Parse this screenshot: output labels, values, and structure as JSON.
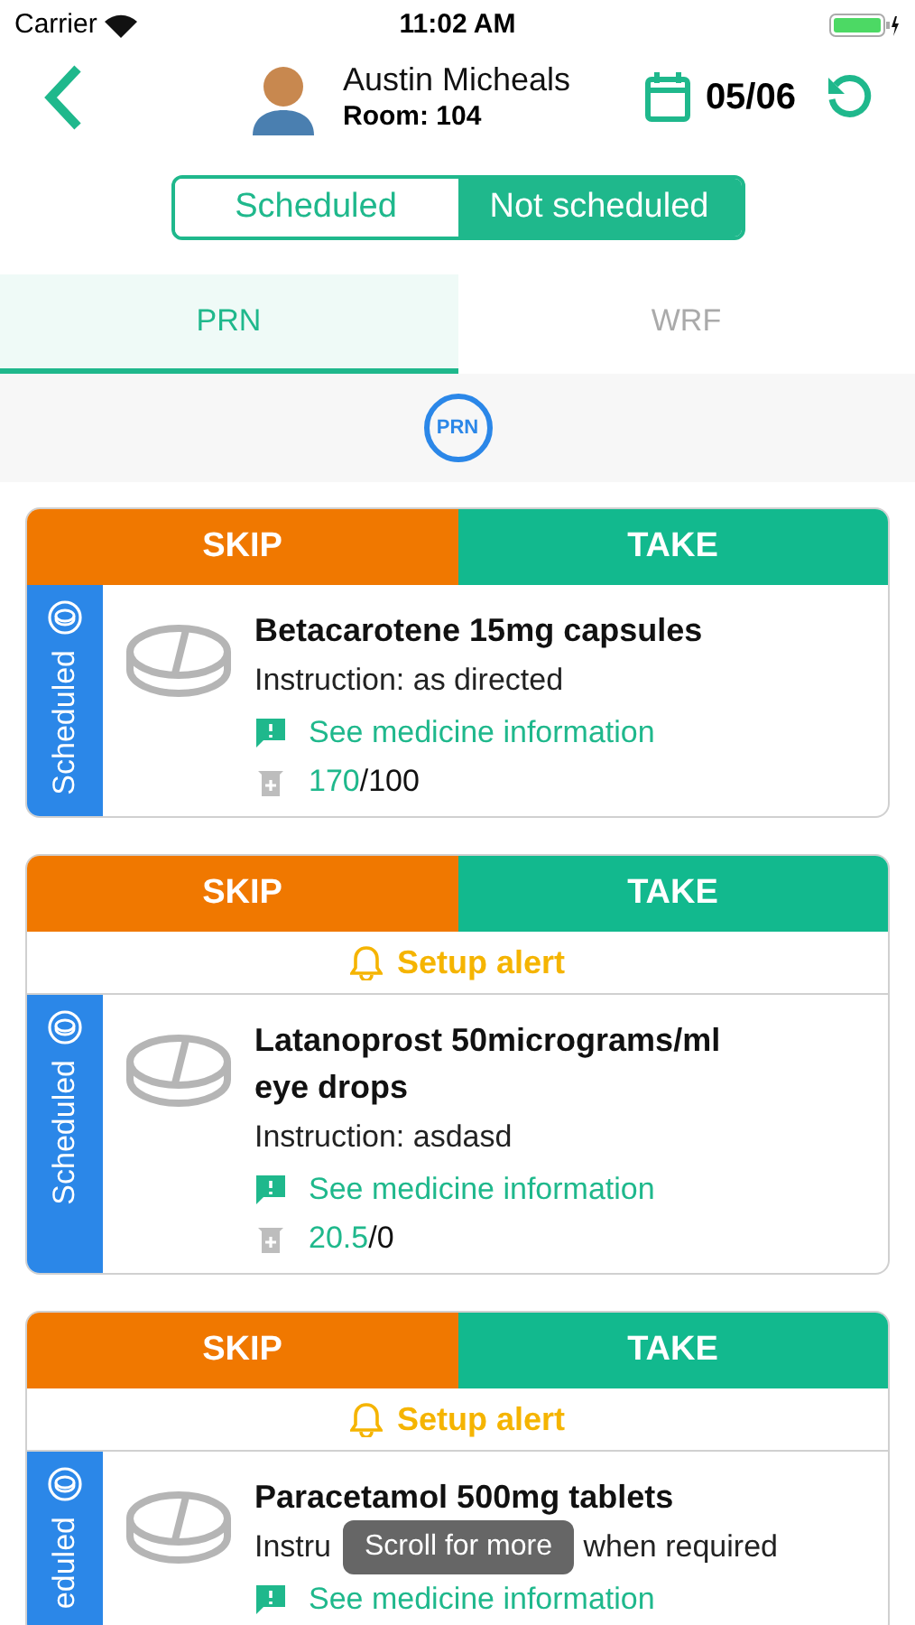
{
  "status_bar": {
    "carrier": "Carrier",
    "time": "11:02 AM"
  },
  "header": {
    "name": "Austin Micheals",
    "room": "Room: 104",
    "date": "05/06"
  },
  "segments": [
    {
      "label": "Scheduled",
      "selected": false
    },
    {
      "label": "Not scheduled",
      "selected": true
    }
  ],
  "tabs": [
    {
      "label": "PRN",
      "selected": true
    },
    {
      "label": "WRF",
      "selected": false
    }
  ],
  "filter_badge": "PRN",
  "cards": [
    {
      "skip": "SKIP",
      "take": "TAKE",
      "side_label": "Scheduled",
      "name": "Betacarotene 15mg capsules",
      "instruction": "Instruction: as directed",
      "info_link": "See medicine information",
      "stock_used": "170",
      "stock_total": "/100"
    },
    {
      "skip": "SKIP",
      "take": "TAKE",
      "alert": "Setup alert",
      "side_label": "Scheduled",
      "name": "Latanoprost 50micrograms/ml eye drops",
      "instruction": "Instruction: asdasd",
      "info_link": "See medicine information",
      "stock_used": "20.5",
      "stock_total": "/0"
    },
    {
      "skip": "SKIP",
      "take": "TAKE",
      "alert": "Setup alert",
      "side_label": "eduled",
      "name": "Paracetamol 500mg tablets",
      "instruction_parts": [
        "Instru",
        "when required"
      ],
      "info_link": "See medicine information"
    }
  ],
  "toast": "Scroll for more"
}
